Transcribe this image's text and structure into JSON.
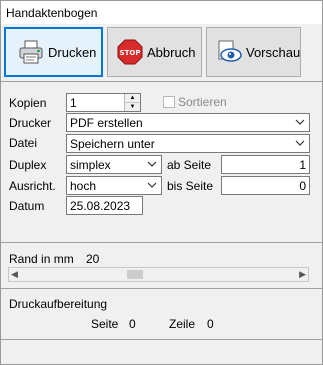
{
  "window": {
    "title": "Handaktenbogen"
  },
  "toolbar": {
    "print_label": "Drucken",
    "cancel_label": "Abbruch",
    "cancel_sign": "STOP",
    "preview_label": "Vorschau"
  },
  "form": {
    "copies_label": "Kopien",
    "copies_value": "1",
    "sort_label": "Sortieren",
    "sort_checked": false,
    "printer_label": "Drucker",
    "printer_value": "PDF erstellen",
    "file_label": "Datei",
    "file_value": "Speichern unter",
    "duplex_label": "Duplex",
    "duplex_value": "simplex",
    "from_page_label": "ab Seite",
    "from_page_value": "1",
    "orientation_label": "Ausricht.",
    "orientation_value": "hoch",
    "to_page_label": "bis Seite",
    "to_page_value": "0",
    "date_label": "Datum",
    "date_value": "25.08.2023"
  },
  "margin": {
    "label": "Rand in mm",
    "value": "20"
  },
  "processing": {
    "title": "Druckaufbereitung",
    "page_label": "Seite",
    "page_value": "0",
    "line_label": "Zeile",
    "line_value": "0"
  },
  "colors": {
    "focus_border": "#0078d7",
    "stop_red": "#d82b2b"
  }
}
